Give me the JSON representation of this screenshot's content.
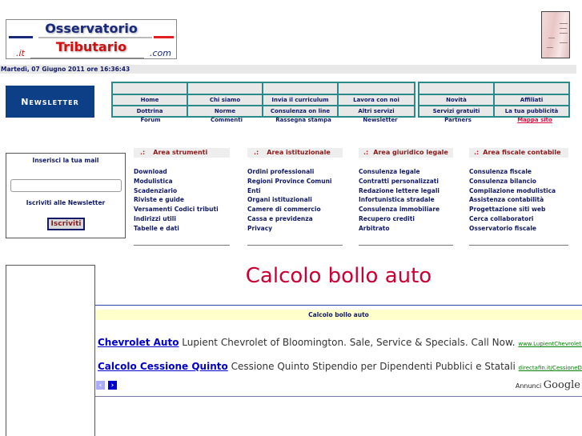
{
  "header": {
    "logo": {
      "line1": "Osservatorio",
      "line2": "Tributario",
      "left_suffix": ".it",
      "right_suffix": ".com"
    },
    "date_text": "Martedì, 07 Giugno 2011 ore 16:36:43"
  },
  "newsletter_banner": "Newsletter",
  "nav": {
    "left": {
      "row1": [
        "Home",
        "Chi siamo",
        "Invia il curriculum",
        "Lavora con noi"
      ],
      "row2": [
        "Dottrina",
        "Norme",
        "Consulenza on line",
        "Altri servizi"
      ],
      "row3": [
        "Forum",
        "Commenti",
        "Rassegna stampa",
        "Newsletter"
      ]
    },
    "right": {
      "row1": [
        "Novità",
        "Affiliati"
      ],
      "row2": [
        "Servizi gratuiti",
        "La tua pubblicità"
      ],
      "row3": [
        "Partners",
        "Mappa sito"
      ]
    }
  },
  "subscribe": {
    "label": "Inserisci la tua mail",
    "email_value": "",
    "caption": "Iscriviti alle Newsletter",
    "button": "Iscriviti"
  },
  "areas": [
    {
      "title": "Area strumenti",
      "items": [
        "Download",
        "Modulistica",
        "Scadenziario",
        "Riviste e guide",
        "Versamenti Codici tributi",
        "Indirizzi utili",
        "Tabelle e dati"
      ]
    },
    {
      "title": "Area istituzionale",
      "items": [
        "Ordini professionali",
        "Regioni Province Comuni",
        "Enti",
        "Organi istituzionali",
        "Camere di commercio",
        "Cassa e previdenza",
        "Privacy"
      ]
    },
    {
      "title": "Area giuridico legale",
      "items": [
        "Consulenza legale",
        "Contratti personalizzati",
        "Redazione lettere legali",
        "Infortunistica stradale",
        "Consulenza immobiliare",
        "Recupero crediti",
        "Arbitrato"
      ]
    },
    {
      "title": "Area fiscale contabile",
      "items": [
        "Consulenza fiscale",
        "Consulenza bilancio",
        "Compilazione modulistica",
        "Assistenza contabilità",
        "Progettazione siti web",
        "Cerca collaboratori",
        "Osservatorio fiscale"
      ]
    }
  ],
  "content": {
    "page_title": "Calcolo bollo auto",
    "section_bar": "Calcolo bollo auto",
    "ads": [
      {
        "title": "Chevrolet Auto",
        "text": "Lupient Chevrolet of Bloomington. Sale, Service & Specials. Call Now.",
        "url": "www.LupientChevrolet.cc"
      },
      {
        "title": "Calcolo Cessione Quinto",
        "text": "Cessione Quinto Stipendio per Dipendenti Pubblici e Statali",
        "url": "directafin.it/CessioneDe"
      }
    ],
    "ads_prev": "‹",
    "ads_next": "›",
    "ads_label": "Annunci",
    "ads_brand": "Google"
  },
  "colors": {
    "navy": "#111a66",
    "teal_border": "#2a8a8a",
    "title_red": "#cc0033",
    "banner_blue": "#0d3f87",
    "area_red": "#8b1a1a"
  }
}
